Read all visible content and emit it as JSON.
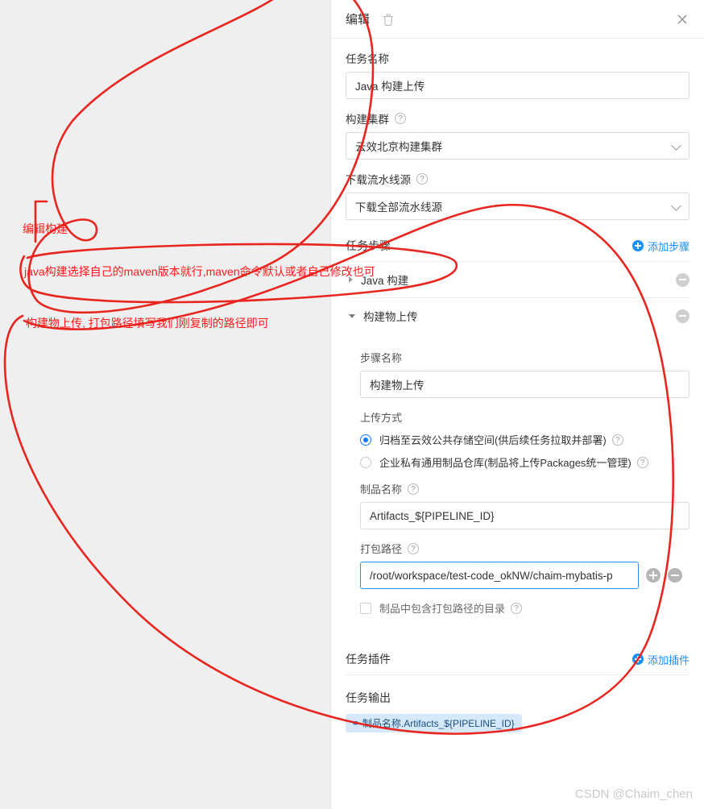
{
  "annotations": {
    "color": "#ff1a1a",
    "notes": [
      {
        "text": "编辑构建"
      },
      {
        "text": "java构建选择自己的maven版本就行,maven命令默认或者自己修改也可"
      },
      {
        "text": "构建物上传, 打包路径填写我们刚复制的路径即可"
      }
    ]
  },
  "panel": {
    "header": {
      "title": "编辑",
      "delete_icon": "trash-icon",
      "close_icon": "close-icon"
    },
    "task_name": {
      "label": "任务名称",
      "value": "Java 构建上传"
    },
    "build_cluster": {
      "label": "构建集群",
      "help": "?",
      "value": "云效北京构建集群"
    },
    "download_source": {
      "label": "下载流水线源",
      "help": "?",
      "value": "下载全部流水线源"
    },
    "task_steps": {
      "title": "任务步骤",
      "add_label": "添加步骤",
      "steps": [
        {
          "name": "Java 构建",
          "expanded": false
        },
        {
          "name": "构建物上传",
          "expanded": true
        }
      ]
    },
    "step_detail": {
      "step_name": {
        "label": "步骤名称",
        "value": "构建物上传"
      },
      "upload_method": {
        "label": "上传方式",
        "options": [
          {
            "label": "归档至云效公共存储空间(供后续任务拉取并部署)",
            "selected": true,
            "help": "?"
          },
          {
            "label": "企业私有通用制品仓库(制品将上传Packages统一管理)",
            "selected": false,
            "help": "?"
          }
        ]
      },
      "artifact_name": {
        "label": "制品名称",
        "help": "?",
        "value": "Artifacts_${PIPELINE_ID}"
      },
      "package_path": {
        "label": "打包路径",
        "help": "?",
        "value": "/root/workspace/test-code_okNW/chaim-mybatis-p",
        "add_button": "add-path-button",
        "remove_button": "remove-path-button"
      },
      "include_dir": {
        "label": "制品中包含打包路径的目录",
        "help": "?",
        "checked": false
      }
    },
    "task_plugins": {
      "title": "任务插件",
      "add_label": "添加插件"
    },
    "task_output": {
      "title": "任务输出",
      "badge": "制品名称.Artifacts_${PIPELINE_ID}",
      "badge_icon": "link-icon"
    }
  },
  "watermark": "CSDN @Chaim_chen"
}
